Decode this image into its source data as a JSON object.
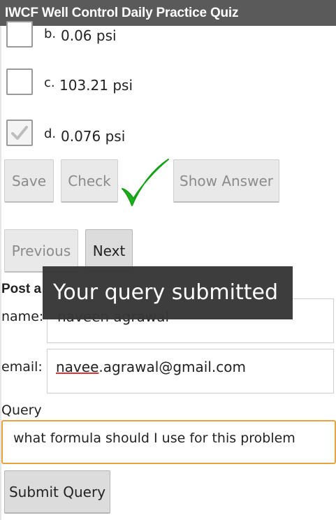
{
  "title": "IWCF Well Control Daily Practice Quiz",
  "options": [
    {
      "letter": "b.",
      "text": "0.06 psi",
      "checked": false
    },
    {
      "letter": "c.",
      "text": "103.21 psi",
      "checked": false
    },
    {
      "letter": "d.",
      "text": "0.076 psi",
      "checked": true
    }
  ],
  "actions": {
    "save": "Save",
    "check": "Check",
    "show_answer": "Show Answer",
    "result_icon": "green-checkmark-icon"
  },
  "nav": {
    "previous": "Previous",
    "next": "Next"
  },
  "query_form": {
    "heading": "Post a",
    "name_label": "name:",
    "name_value": "naveen agrawal",
    "email_label": "email:",
    "email_value_misspelled": "navee",
    "email_value_rest": ".agrawal@gmail.com",
    "query_label": "Query",
    "query_value": "what formula should I use for this problem",
    "submit": "Submit Query"
  },
  "toast": "Your query submitted",
  "colors": {
    "titlebar": "#5a5a5a",
    "check_green": "#1db31d",
    "focus_border": "#e8a33d",
    "toast_bg": "#373737"
  }
}
